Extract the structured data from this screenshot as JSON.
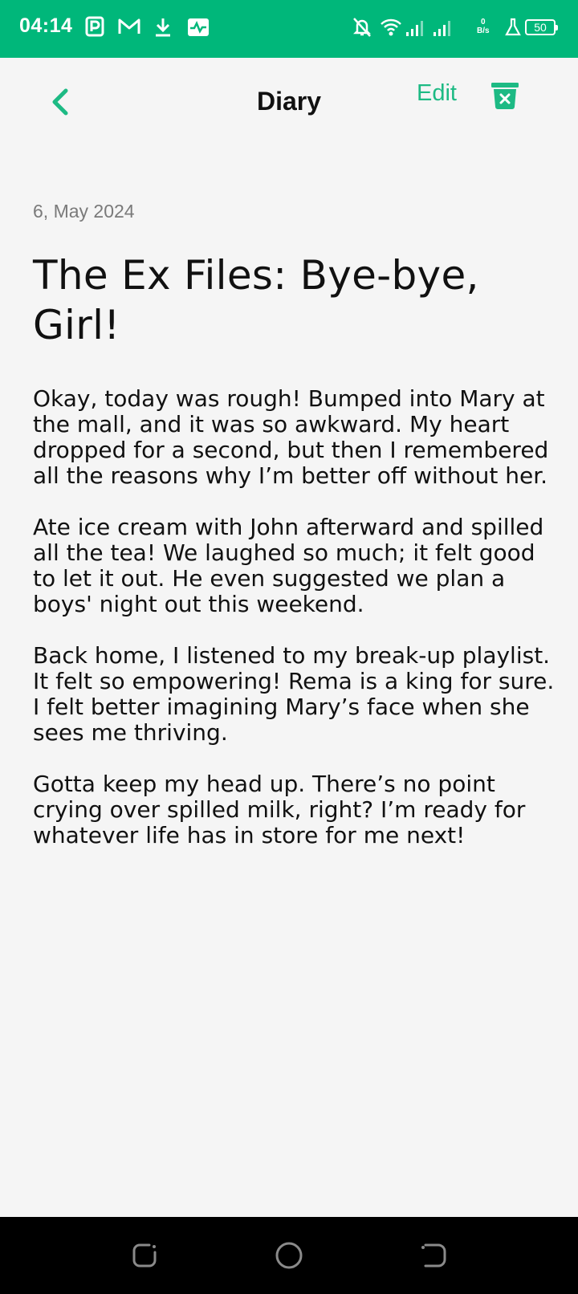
{
  "status_bar": {
    "time": "04:14",
    "net_speed_value": "0",
    "net_speed_unit": "B/s",
    "battery": "50"
  },
  "header": {
    "title": "Diary",
    "edit_label": "Edit"
  },
  "entry": {
    "date": "6, May 2024",
    "title": "The Ex Files: Bye-bye, Girl!",
    "paragraphs": [
      "Okay, today was rough! Bumped into Mary at the mall, and it was so awkward. My heart dropped for a second, but then I remembered all the reasons why I’m better off without her.",
      "Ate ice cream with John afterward and spilled all the tea! We laughed so much; it felt good to let it out. He even suggested we plan a boys' night out this weekend.",
      "Back home, I listened to my break-up playlist. It felt so empowering! Rema is a king for sure. I felt better imagining Mary’s face when she sees me thriving.",
      "Gotta keep my head up. There’s no point crying over spilled milk, right? I’m ready for whatever life has in store for me next!"
    ]
  },
  "colors": {
    "status_bar": "#00b77a",
    "accent": "#1dba84",
    "background": "#f5f5f5"
  },
  "icons": {
    "back": "chevron-left-icon",
    "delete": "trash-icon",
    "nav_recents": "recents-icon",
    "nav_home": "home-circle-icon",
    "nav_back": "back-icon"
  }
}
